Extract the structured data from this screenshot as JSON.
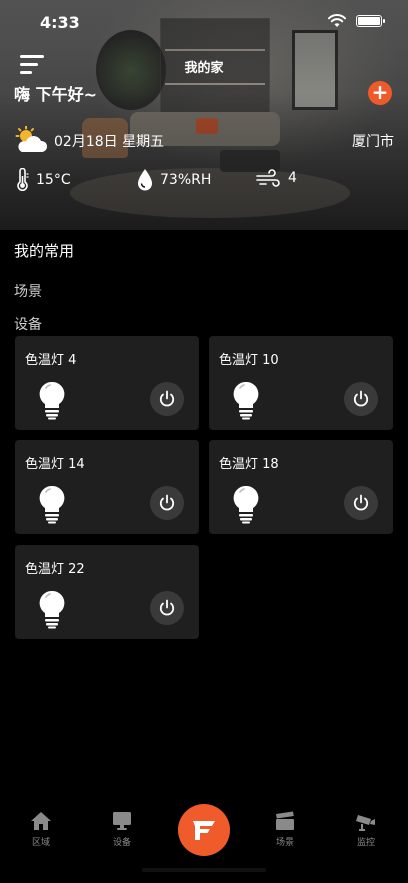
{
  "status_bar": {
    "time": "4:33"
  },
  "header": {
    "home_name": "我的家",
    "greeting": "嗨 下午好~",
    "add_label": "+"
  },
  "weather": {
    "date": "02月18日 星期五",
    "city": "厦门市",
    "temperature": "15°C",
    "humidity": "73%RH",
    "wind": "4",
    "icons": [
      "partly-cloudy-icon",
      "thermometer-icon",
      "humidity-drop-icon",
      "wind-icon"
    ]
  },
  "favorites": {
    "title": "我的常用",
    "scenes_label": "场景",
    "devices_label": "设备",
    "devices": [
      {
        "name": "色温灯 4"
      },
      {
        "name": "色温灯 10"
      },
      {
        "name": "色温灯 14"
      },
      {
        "name": "色温灯 18"
      },
      {
        "name": "色温灯 22"
      }
    ]
  },
  "tabbar": {
    "tabs": [
      {
        "label": "区域",
        "icon": "house-icon"
      },
      {
        "label": "设备",
        "icon": "device-monitor-icon"
      },
      {
        "label": "",
        "icon": "brand-logo-icon"
      },
      {
        "label": "场景",
        "icon": "clapperboard-icon"
      },
      {
        "label": "监控",
        "icon": "camera-icon"
      }
    ]
  },
  "colors": {
    "accent": "#ef5b2b",
    "background": "#000000",
    "card": "#1f1f1f"
  }
}
